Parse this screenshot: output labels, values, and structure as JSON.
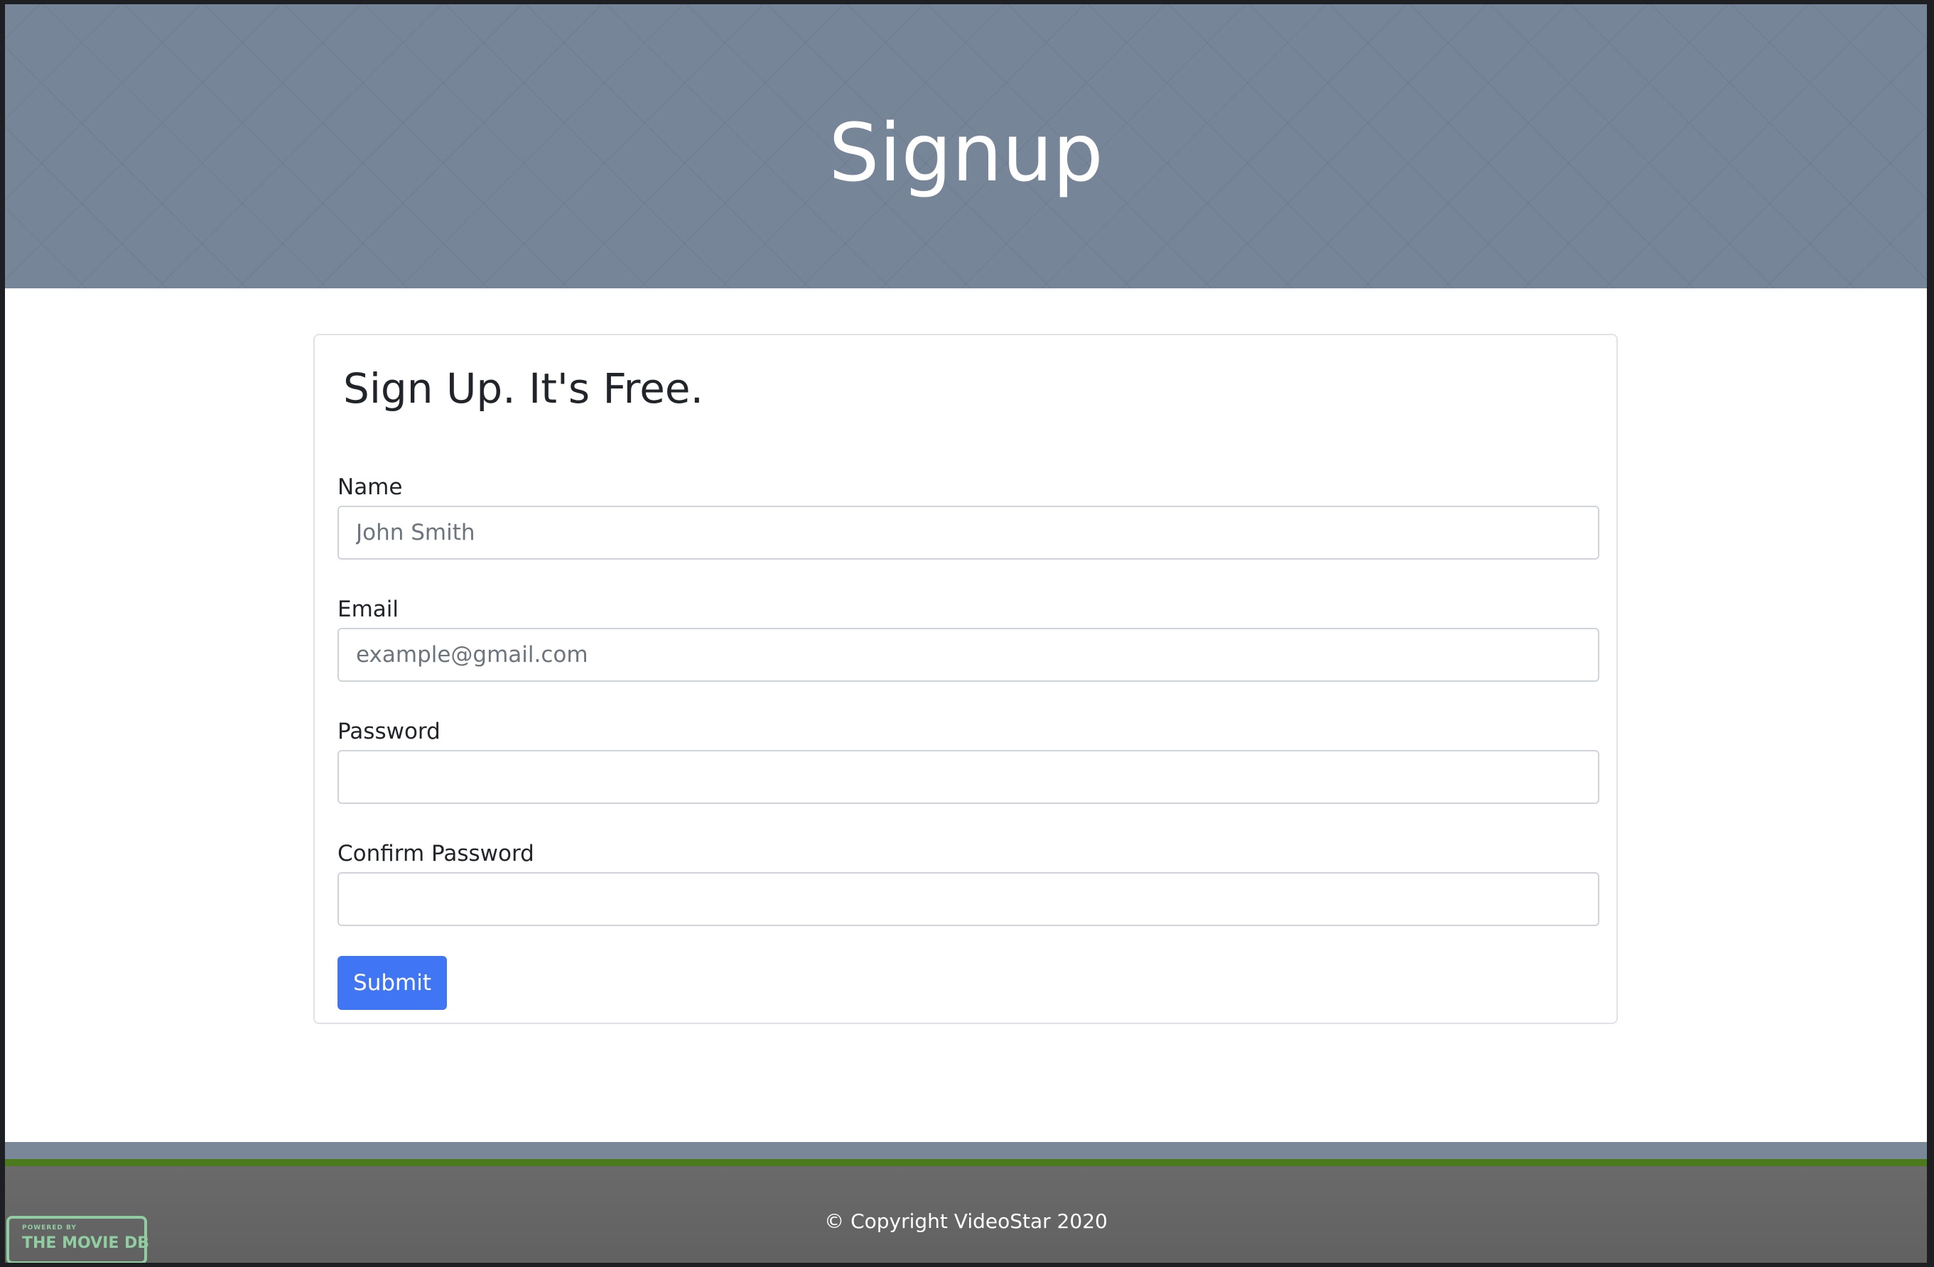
{
  "hero": {
    "title": "Signup"
  },
  "form": {
    "heading": "Sign Up. It's Free.",
    "fields": [
      {
        "label": "Name",
        "placeholder": "John Smith",
        "value": ""
      },
      {
        "label": "Email",
        "placeholder": "example@gmail.com",
        "value": ""
      },
      {
        "label": "Password",
        "placeholder": "",
        "value": ""
      },
      {
        "label": "Confirm Password",
        "placeholder": "",
        "value": ""
      }
    ],
    "submit_label": "Submit"
  },
  "footer": {
    "copyright": "© Copyright VideoStar 2020",
    "logo": {
      "small_text": "POWERED BY",
      "big_text": "THE MOVIE DB"
    }
  },
  "colors": {
    "hero_bg": "#778599",
    "primary_button": "#4076f3",
    "footer_stripe": "#4a7a1c",
    "footer_bg": "#666666",
    "tmdb_green": "#90cea1"
  }
}
